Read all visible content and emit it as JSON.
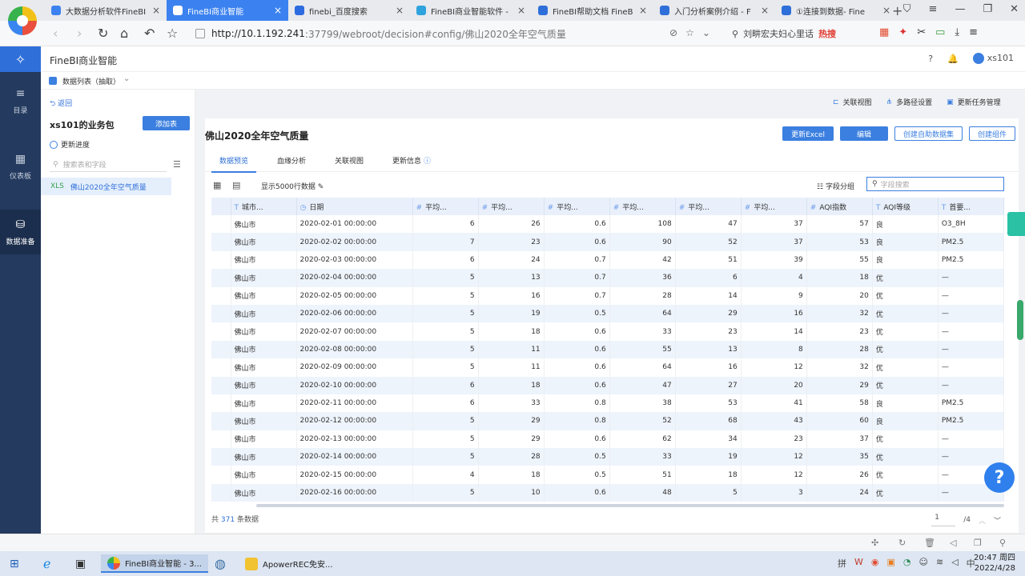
{
  "browser": {
    "tabs": [
      {
        "title": "大数据分析软件FineBI",
        "color": "#3b82f0",
        "active": false
      },
      {
        "title": "FineBI商业智能",
        "color": "#3b82f0",
        "active": true
      },
      {
        "title": "finebi_百度搜索",
        "color": "#2d6be0",
        "active": false
      },
      {
        "title": "FineBI商业智能软件 -",
        "color": "#2fa3dd",
        "active": false
      },
      {
        "title": "FineBI帮助文档 FineB",
        "color": "#2f6fd9",
        "active": false
      },
      {
        "title": "入门分析案例介绍 - F",
        "color": "#2f6fd9",
        "active": false
      },
      {
        "title": "①连接到数据- Fine",
        "color": "#2f6fd9",
        "active": false
      }
    ],
    "url_host": "http://10.1.192.241",
    "url_rest": ":37799/webroot/decision#config/佛山2020全年空气质量",
    "search_text": "刘畊宏夫妇心里话",
    "search_hot": "热搜"
  },
  "rail": {
    "items": [
      {
        "label": "目录",
        "icon": "≡"
      },
      {
        "label": "仪表板",
        "icon": "▦"
      },
      {
        "label": "数据准备",
        "icon": "⛁"
      }
    ]
  },
  "header": {
    "title": "FineBI商业智能",
    "help_icon": "?",
    "bell_icon": "🔔",
    "user": "xs101"
  },
  "subheader": {
    "label": "数据列表（抽取）"
  },
  "left_panel": {
    "back": "返回",
    "package_title": "xs101的业务包",
    "add_table": "添加表",
    "progress": "更新进度",
    "search_placeholder": "搜索表和字段",
    "tables": [
      "佛山2020全年空气质量"
    ]
  },
  "top_actions": [
    "关联视图",
    "多路径设置",
    "更新任务管理"
  ],
  "main": {
    "title": "佛山2020全年空气质量",
    "buttons": [
      "更新Excel",
      "编辑",
      "创建自助数据集",
      "创建组件"
    ],
    "tabs": [
      "数据预览",
      "血缘分析",
      "关联视图",
      "更新信息"
    ],
    "rows_label": "显示5000行数据",
    "group_label": "字段分组",
    "field_search_placeholder": "字段搜索"
  },
  "table": {
    "columns": [
      {
        "label": "城市...",
        "type": "T"
      },
      {
        "label": "日期",
        "type": "◷"
      },
      {
        "label": "平均...",
        "type": "#"
      },
      {
        "label": "平均...",
        "type": "#"
      },
      {
        "label": "平均...",
        "type": "#"
      },
      {
        "label": "平均...",
        "type": "#"
      },
      {
        "label": "平均...",
        "type": "#"
      },
      {
        "label": "平均...",
        "type": "#"
      },
      {
        "label": "AQI指数",
        "type": "#"
      },
      {
        "label": "AQI等级",
        "type": "T"
      },
      {
        "label": "首要...",
        "type": "T"
      }
    ],
    "rows": [
      [
        "佛山市",
        "2020-02-01 00:00:00",
        "6",
        "26",
        "0.6",
        "108",
        "47",
        "37",
        "57",
        "良",
        "O3_8H"
      ],
      [
        "佛山市",
        "2020-02-02 00:00:00",
        "7",
        "23",
        "0.6",
        "90",
        "52",
        "37",
        "53",
        "良",
        "PM2.5"
      ],
      [
        "佛山市",
        "2020-02-03 00:00:00",
        "6",
        "24",
        "0.7",
        "42",
        "51",
        "39",
        "55",
        "良",
        "PM2.5"
      ],
      [
        "佛山市",
        "2020-02-04 00:00:00",
        "5",
        "13",
        "0.7",
        "36",
        "6",
        "4",
        "18",
        "优",
        "—"
      ],
      [
        "佛山市",
        "2020-02-05 00:00:00",
        "5",
        "16",
        "0.7",
        "28",
        "14",
        "9",
        "20",
        "优",
        "—"
      ],
      [
        "佛山市",
        "2020-02-06 00:00:00",
        "5",
        "19",
        "0.5",
        "64",
        "29",
        "16",
        "32",
        "优",
        "—"
      ],
      [
        "佛山市",
        "2020-02-07 00:00:00",
        "5",
        "18",
        "0.6",
        "33",
        "23",
        "14",
        "23",
        "优",
        "—"
      ],
      [
        "佛山市",
        "2020-02-08 00:00:00",
        "5",
        "11",
        "0.6",
        "55",
        "13",
        "8",
        "28",
        "优",
        "—"
      ],
      [
        "佛山市",
        "2020-02-09 00:00:00",
        "5",
        "11",
        "0.6",
        "64",
        "16",
        "12",
        "32",
        "优",
        "—"
      ],
      [
        "佛山市",
        "2020-02-10 00:00:00",
        "6",
        "18",
        "0.6",
        "47",
        "27",
        "20",
        "29",
        "优",
        "—"
      ],
      [
        "佛山市",
        "2020-02-11 00:00:00",
        "6",
        "33",
        "0.8",
        "38",
        "53",
        "41",
        "58",
        "良",
        "PM2.5"
      ],
      [
        "佛山市",
        "2020-02-12 00:00:00",
        "5",
        "29",
        "0.8",
        "52",
        "68",
        "43",
        "60",
        "良",
        "PM2.5"
      ],
      [
        "佛山市",
        "2020-02-13 00:00:00",
        "5",
        "29",
        "0.6",
        "62",
        "34",
        "23",
        "37",
        "优",
        "—"
      ],
      [
        "佛山市",
        "2020-02-14 00:00:00",
        "5",
        "28",
        "0.5",
        "33",
        "19",
        "12",
        "35",
        "优",
        "—"
      ],
      [
        "佛山市",
        "2020-02-15 00:00:00",
        "4",
        "18",
        "0.5",
        "51",
        "18",
        "12",
        "26",
        "优",
        "—"
      ],
      [
        "佛山市",
        "2020-02-16 00:00:00",
        "5",
        "10",
        "0.6",
        "48",
        "5",
        "3",
        "24",
        "优",
        "—"
      ]
    ]
  },
  "footer": {
    "count_prefix": "共",
    "count": "371",
    "count_suffix": "条数据",
    "page": "1",
    "total_pages": "/4"
  },
  "taskbar": {
    "items": [
      "FineBI商业智能 - 3...",
      "ApowerREC免安..."
    ],
    "time": "20:47 周四",
    "date": "2022/4/28",
    "ime": "拼"
  },
  "help_label": "?"
}
